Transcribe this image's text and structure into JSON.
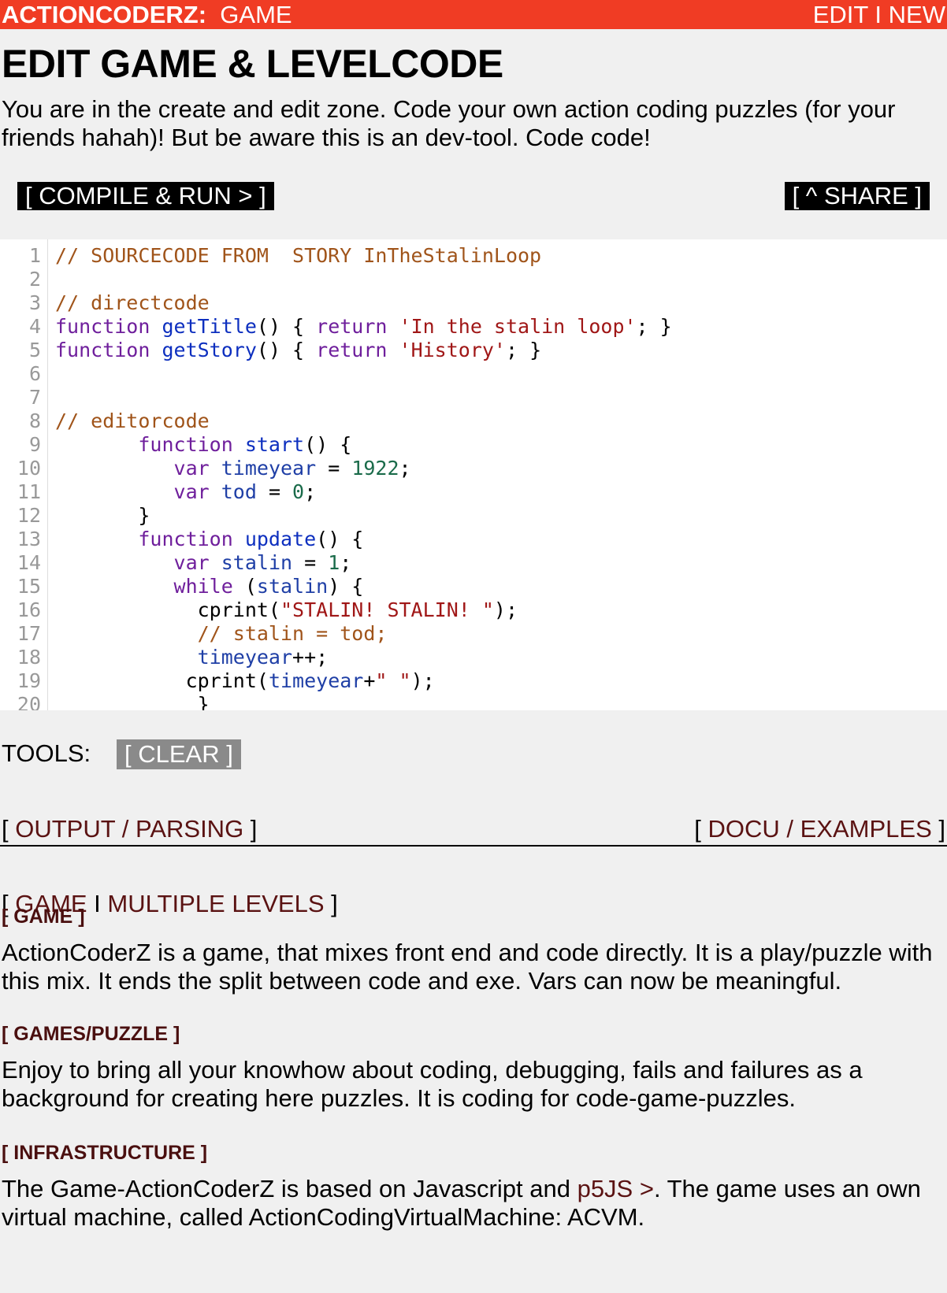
{
  "header": {
    "brand": "ACTIONCODERZ:",
    "section": "GAME",
    "edit": "EDIT",
    "sep": "I",
    "new": "NEW"
  },
  "page": {
    "title": "EDIT GAME & LEVELCODE",
    "intro": "You are in the create and edit zone. Code your own action coding puzzles (for your friends hahah)! But be aware this is an dev-tool. Code code!"
  },
  "toolbar": {
    "run_label": "[ COMPILE & RUN > ]",
    "share_label": "[ ^ SHARE ]"
  },
  "editor": {
    "lines": [
      {
        "n": "1",
        "tokens": [
          [
            "cm",
            "// SOURCECODE FROM  STORY InTheStalinLoop"
          ]
        ]
      },
      {
        "n": "2",
        "tokens": []
      },
      {
        "n": "3",
        "tokens": [
          [
            "cm",
            "// directcode"
          ]
        ]
      },
      {
        "n": "4",
        "tokens": [
          [
            "kw",
            "function "
          ],
          [
            "fn",
            "getTitle"
          ],
          [
            "",
            "() { "
          ],
          [
            "kw",
            "return "
          ],
          [
            "st",
            "'In the stalin loop'"
          ],
          [
            "",
            "; }"
          ]
        ]
      },
      {
        "n": "5",
        "tokens": [
          [
            "kw",
            "function "
          ],
          [
            "fn",
            "getStory"
          ],
          [
            "",
            "() { "
          ],
          [
            "kw",
            "return "
          ],
          [
            "st",
            "'History'"
          ],
          [
            "",
            "; }"
          ]
        ]
      },
      {
        "n": "6",
        "tokens": []
      },
      {
        "n": "7",
        "tokens": []
      },
      {
        "n": "8",
        "tokens": [
          [
            "cm",
            "// editorcode"
          ]
        ]
      },
      {
        "n": "9",
        "tokens": [
          [
            "",
            "       "
          ],
          [
            "kw",
            "function "
          ],
          [
            "fn",
            "start"
          ],
          [
            "",
            "() {"
          ]
        ]
      },
      {
        "n": "10",
        "tokens": [
          [
            "",
            "          "
          ],
          [
            "kw",
            "var "
          ],
          [
            "vr",
            "timeyear"
          ],
          [
            "",
            " = "
          ],
          [
            "nm",
            "1922"
          ],
          [
            "",
            ";"
          ]
        ]
      },
      {
        "n": "11",
        "tokens": [
          [
            "",
            "          "
          ],
          [
            "kw",
            "var "
          ],
          [
            "vr",
            "tod"
          ],
          [
            "",
            " = "
          ],
          [
            "nm",
            "0"
          ],
          [
            "",
            ";"
          ]
        ]
      },
      {
        "n": "12",
        "tokens": [
          [
            "",
            "       }"
          ]
        ]
      },
      {
        "n": "13",
        "tokens": [
          [
            "",
            "       "
          ],
          [
            "kw",
            "function "
          ],
          [
            "fn",
            "update"
          ],
          [
            "",
            "() {"
          ]
        ]
      },
      {
        "n": "14",
        "tokens": [
          [
            "",
            "          "
          ],
          [
            "kw",
            "var "
          ],
          [
            "vr",
            "stalin"
          ],
          [
            "",
            " = "
          ],
          [
            "nm",
            "1"
          ],
          [
            "",
            ";"
          ]
        ]
      },
      {
        "n": "15",
        "tokens": [
          [
            "",
            "          "
          ],
          [
            "kw",
            "while "
          ],
          [
            "",
            "("
          ],
          [
            "vr",
            "stalin"
          ],
          [
            "",
            ") {"
          ]
        ]
      },
      {
        "n": "16",
        "tokens": [
          [
            "",
            "            cprint("
          ],
          [
            "st",
            "\"STALIN! STALIN! \""
          ],
          [
            "",
            ");"
          ]
        ]
      },
      {
        "n": "17",
        "tokens": [
          [
            "",
            "            "
          ],
          [
            "cm",
            "// stalin = tod;"
          ]
        ]
      },
      {
        "n": "18",
        "tokens": [
          [
            "",
            "            "
          ],
          [
            "vr",
            "timeyear"
          ],
          [
            "",
            "++;"
          ]
        ]
      },
      {
        "n": "19",
        "tokens": [
          [
            "",
            "           cprint("
          ],
          [
            "vr",
            "timeyear"
          ],
          [
            "",
            "+"
          ],
          [
            "st",
            "\" \""
          ],
          [
            "",
            ");"
          ]
        ]
      },
      {
        "n": "20",
        "tokens": [
          [
            "",
            "            }"
          ]
        ]
      }
    ]
  },
  "tools": {
    "label": "TOOLS:",
    "clear_label": "[ CLEAR ]"
  },
  "tabs": {
    "output": "OUTPUT / PARSING",
    "docu": "DOCU / EXAMPLES"
  },
  "levels": {
    "game": "GAME",
    "sep": "I",
    "multiple": "MULTIPLE LEVELS"
  },
  "sections": {
    "game_title": "[ GAME ]",
    "game_text": "ActionCoderZ is a game, that mixes front end and code directly. It is a play/puzzle with this mix. It ends the split between code and exe. Vars can now be meaningful.",
    "puzzle_title": "[ GAMES/PUZZLE ]",
    "puzzle_text": "Enjoy to bring all your knowhow about coding, debugging, fails and failures as a background for creating here puzzles. It is coding for code-game-puzzles.",
    "infra_title": "[ INFRASTRUCTURE ]",
    "infra_text_a": "The Game-ActionCoderZ is based on Javascript and ",
    "infra_link": "p5JS >",
    "infra_text_b": ". The game uses an own virtual machine, called ActionCodingVirtualMachine: ACVM."
  }
}
